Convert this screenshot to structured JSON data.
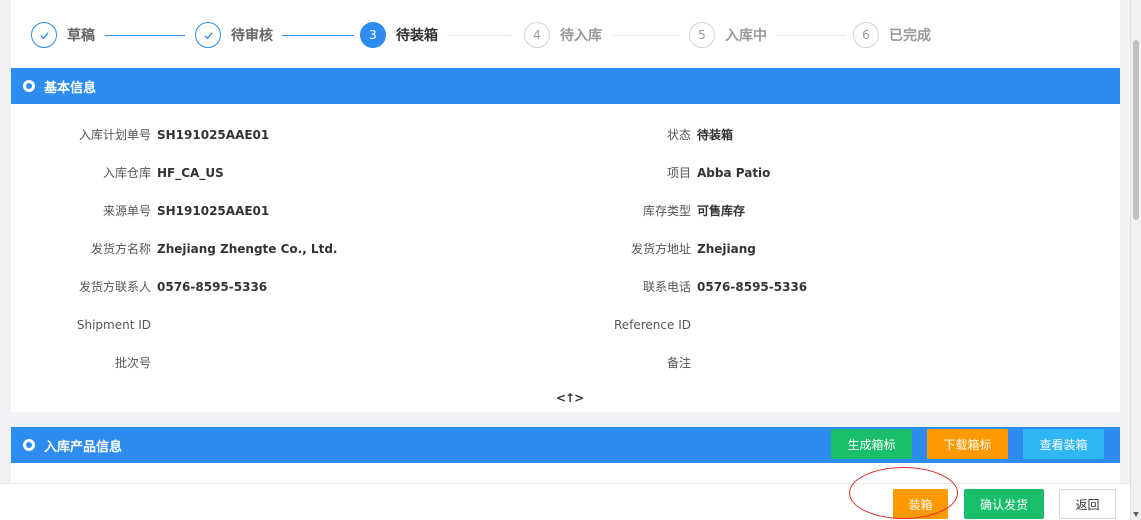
{
  "steps": [
    {
      "num": "1",
      "label": "草稿",
      "state": "done"
    },
    {
      "num": "2",
      "label": "待审核",
      "state": "done"
    },
    {
      "num": "3",
      "label": "待装箱",
      "state": "active"
    },
    {
      "num": "4",
      "label": "待入库",
      "state": "todo"
    },
    {
      "num": "5",
      "label": "入库中",
      "state": "todo"
    },
    {
      "num": "6",
      "label": "已完成",
      "state": "todo"
    }
  ],
  "basic_info": {
    "title": "基本信息",
    "fields": [
      {
        "label": "入库计划单号",
        "value": "SH191025AAE01"
      },
      {
        "label": "状态",
        "value": "待装箱"
      },
      {
        "label": "入库仓库",
        "value": "HF_CA_US"
      },
      {
        "label": "项目",
        "value": "Abba Patio"
      },
      {
        "label": "来源单号",
        "value": "SH191025AAE01"
      },
      {
        "label": "库存类型",
        "value": "可售库存"
      },
      {
        "label": "发货方名称",
        "value": "Zhejiang Zhengte Co., Ltd."
      },
      {
        "label": "发货方地址",
        "value": "Zhejiang"
      },
      {
        "label": "发货方联系人",
        "value": "0576-8595-5336"
      },
      {
        "label": "联系电话",
        "value": "0576-8595-5336"
      },
      {
        "label": "Shipment ID",
        "value": ""
      },
      {
        "label": "Reference ID",
        "value": ""
      },
      {
        "label": "批次号",
        "value": ""
      },
      {
        "label": "备注",
        "value": ""
      }
    ],
    "collapse_glyph": "<↑>"
  },
  "product_info": {
    "title": "入库产品信息",
    "buttons": {
      "generate_label": "生成箱标",
      "download_label": "下载箱标",
      "view_packing": "查看装箱"
    }
  },
  "footer": {
    "pack_label": "装箱",
    "confirm_ship_label": "确认发货",
    "back_label": "返回"
  },
  "colors": {
    "primary": "#2d8cf0",
    "green": "#19be6b",
    "orange": "#ff9900",
    "light_blue": "#2db7f5"
  }
}
